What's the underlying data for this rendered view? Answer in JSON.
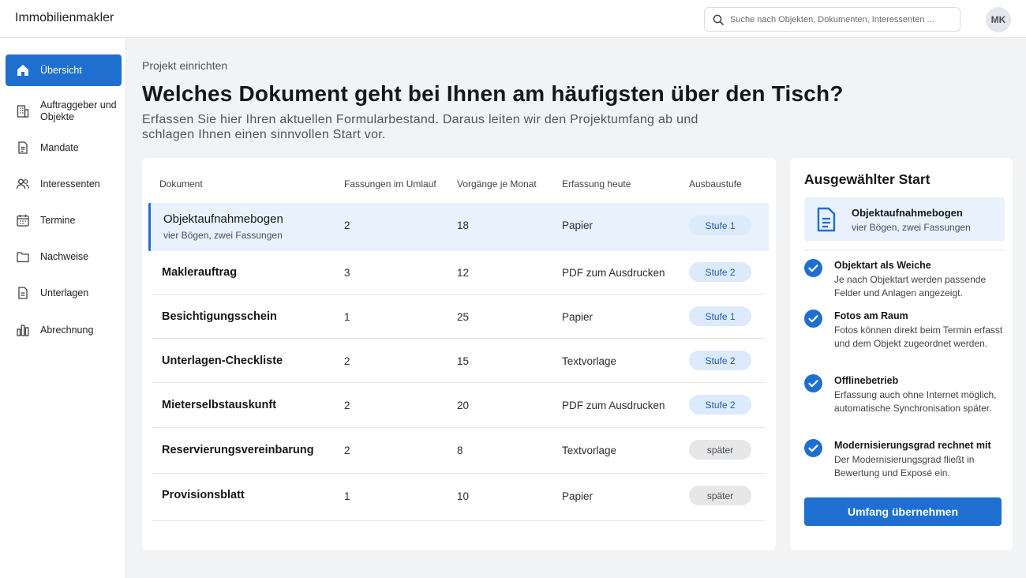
{
  "app": {
    "title": "Immobilienmakler"
  },
  "search": {
    "placeholder": "Suche nach Objekten, Dokumenten, Interessenten ..."
  },
  "user": {
    "initials": "MK"
  },
  "sidebar": {
    "items": [
      {
        "label": "Übersicht",
        "icon": "home-icon",
        "active": true
      },
      {
        "label": "Auftraggeber und Objekte",
        "icon": "building-icon"
      },
      {
        "label": "Mandate",
        "icon": "document-icon"
      },
      {
        "label": "Interessenten",
        "icon": "users-icon"
      },
      {
        "label": "Termine",
        "icon": "calendar-icon"
      },
      {
        "label": "Nachweise",
        "icon": "folder-icon"
      },
      {
        "label": "Unterlagen",
        "icon": "file-text-icon"
      },
      {
        "label": "Abrechnung",
        "icon": "bar-chart-icon"
      }
    ]
  },
  "page": {
    "eyebrow": "Projekt einrichten",
    "headline": "Welches Dokument geht bei Ihnen am häufigsten über den Tisch?",
    "subline": "Erfassen Sie hier Ihren aktuellen Formularbestand. Daraus leiten wir den Projektumfang ab und schlagen Ihnen einen sinnvollen Start vor."
  },
  "table": {
    "columns": [
      "Dokument",
      "Fassungen im Umlauf",
      "Vorgänge je Monat",
      "Erfassung heute",
      "Ausbaustufe"
    ],
    "rows": [
      {
        "name": "Objektaufnahmebogen",
        "sub": "vier Bögen, zwei Fassungen",
        "versions": "2",
        "per_month": "18",
        "capture": "Papier",
        "stage": "Stufe 1",
        "selected": true
      },
      {
        "name": "Maklerauftrag",
        "versions": "3",
        "per_month": "12",
        "capture": "PDF zum Ausdrucken",
        "stage": "Stufe 2"
      },
      {
        "name": "Besichtigungsschein",
        "versions": "1",
        "per_month": "25",
        "capture": "Papier",
        "stage": "Stufe 1"
      },
      {
        "name": "Unterlagen-Checkliste",
        "versions": "2",
        "per_month": "15",
        "capture": "Textvorlage",
        "stage": "Stufe 2"
      },
      {
        "name": "Mieterselbstauskunft",
        "versions": "2",
        "per_month": "20",
        "capture": "PDF zum Ausdrucken",
        "stage": "Stufe 2"
      },
      {
        "name": "Reservierungsvereinbarung",
        "versions": "2",
        "per_month": "8",
        "capture": "Textvorlage",
        "stage": "später"
      },
      {
        "name": "Provisionsblatt",
        "versions": "1",
        "per_month": "10",
        "capture": "Papier",
        "stage": "später"
      }
    ]
  },
  "panel": {
    "title": "Ausgewählter Start",
    "selected_name": "Objektaufnahmebogen",
    "selected_sub": "vier Bögen, zwei Fassungen",
    "features": [
      {
        "title": "Objektart als Weiche",
        "desc": "Je nach Objektart werden passende Felder und Anlagen angezeigt."
      },
      {
        "title": "Fotos am Raum",
        "desc": "Fotos können direkt beim Termin erfasst und dem Objekt zugeordnet werden."
      },
      {
        "title": "Offlinebetrieb",
        "desc": "Erfassung auch ohne Internet möglich, automatische Synchronisation später."
      },
      {
        "title": "Modernisierungsgrad rechnet mit",
        "desc": "Der Modernisierungsgrad fließt in Bewertung und Exposé ein."
      }
    ],
    "cta_label": "Umfang übernehmen"
  },
  "colors": {
    "accent": "#1f6fd0",
    "badge_blue_bg": "#dceafb",
    "badge_grey_bg": "#e6e7e9",
    "selected_row_bg": "#e8f1fc"
  }
}
